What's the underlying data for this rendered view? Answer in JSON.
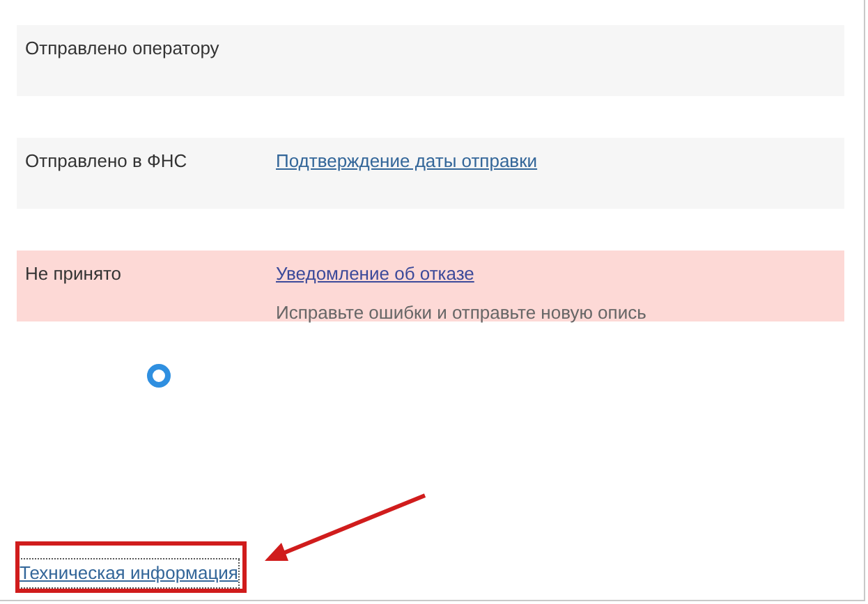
{
  "statuses": [
    {
      "status": "Отправлено оператору",
      "kind": "neutral"
    },
    {
      "status": "Отправлено в ФНС",
      "kind": "neutral",
      "link": "Подтверждение даты отправки"
    },
    {
      "status": "Не принято",
      "kind": "error",
      "link": "Уведомление об отказе",
      "note": "Исправьте ошибки и отправьте новую опись"
    }
  ],
  "tech_link": "Техническая информация"
}
